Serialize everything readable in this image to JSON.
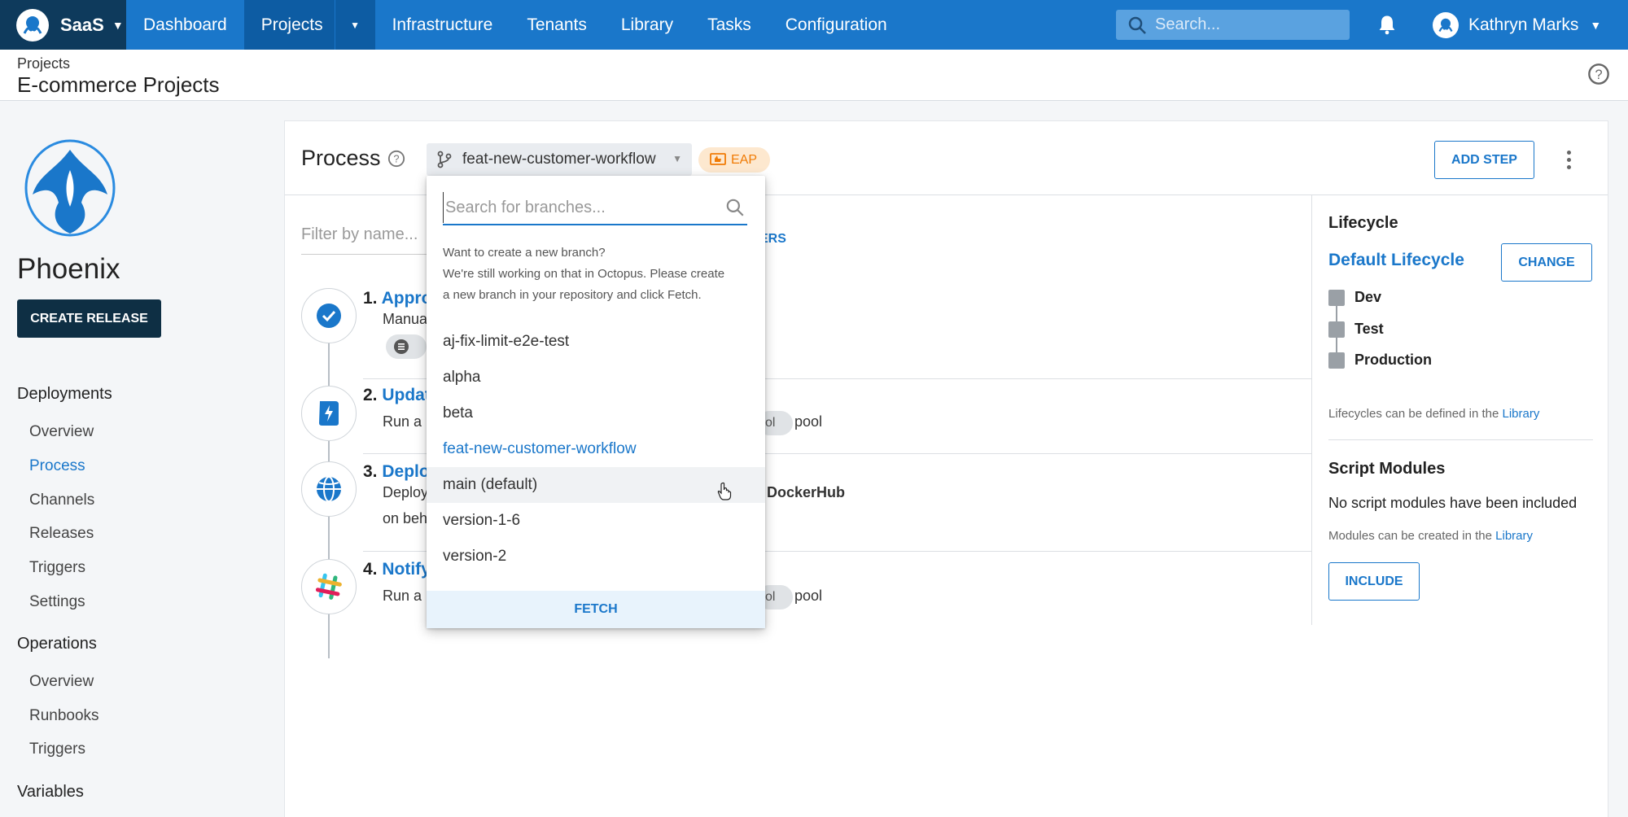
{
  "topnav": {
    "space": "SaaS",
    "items": [
      {
        "label": "Dashboard"
      },
      {
        "label": "Projects"
      },
      {
        "label": "Infrastructure"
      },
      {
        "label": "Tenants"
      },
      {
        "label": "Library"
      },
      {
        "label": "Tasks"
      },
      {
        "label": "Configuration"
      }
    ],
    "search_placeholder": "Search...",
    "user": "Kathryn Marks"
  },
  "header": {
    "breadcrumb": "Projects",
    "title": "E-commerce Projects"
  },
  "sidebar": {
    "project_name": "Phoenix",
    "create_release": "CREATE RELEASE",
    "deployments": {
      "title": "Deployments",
      "items": [
        "Overview",
        "Process",
        "Channels",
        "Releases",
        "Triggers",
        "Settings"
      ]
    },
    "operations": {
      "title": "Operations",
      "items": [
        "Overview",
        "Runbooks",
        "Triggers"
      ]
    },
    "variables": {
      "title": "Variables"
    }
  },
  "process": {
    "title": "Process",
    "branch": "feat-new-customer-workflow",
    "eap": "EAP",
    "add_step": "ADD STEP",
    "filter_placeholder": "Filter by name...",
    "filters_link_partial": "ERS",
    "steps": [
      {
        "num": "1.",
        "title": "Appro",
        "desc": "Manua"
      },
      {
        "num": "2.",
        "title": "Updat",
        "desc": "Run a ",
        "chip_partial": "ol",
        "pool": "pool"
      },
      {
        "num": "3.",
        "title": "Deplo",
        "desc": "Deploy",
        "desc2": "on beh",
        "bold_partial": "DockerHub"
      },
      {
        "num": "4.",
        "title": "Notify",
        "desc": "Run a ",
        "chip_partial": "ol",
        "pool": "pool"
      }
    ]
  },
  "right_panel": {
    "lifecycle_title": "Lifecycle",
    "lifecycle_name": "Default Lifecycle",
    "change": "CHANGE",
    "phases": [
      "Dev",
      "Test",
      "Production"
    ],
    "lifecycle_note": "Lifecycles can be defined in the ",
    "library_link": "Library",
    "script_modules_title": "Script Modules",
    "no_modules": "No script modules have been included",
    "modules_note": "Modules can be created in the ",
    "include": "INCLUDE"
  },
  "branch_dropdown": {
    "search_placeholder": "Search for branches...",
    "info_line1": "Want to create a new branch?",
    "info_line2": "We're still working on that in Octopus. Please create",
    "info_line3": "a new branch in your repository and click Fetch.",
    "branches": [
      "aj-fix-limit-e2e-test",
      "alpha",
      "beta",
      "feat-new-customer-workflow",
      "main (default)",
      "version-1-6",
      "version-2"
    ],
    "selected_index": 3,
    "hover_index": 4,
    "fetch": "FETCH"
  },
  "colors": {
    "nav_blue": "#1a77ca",
    "nav_dark": "#0e3a5c",
    "accent": "#1a77ca",
    "eap_orange": "#f07b05"
  }
}
